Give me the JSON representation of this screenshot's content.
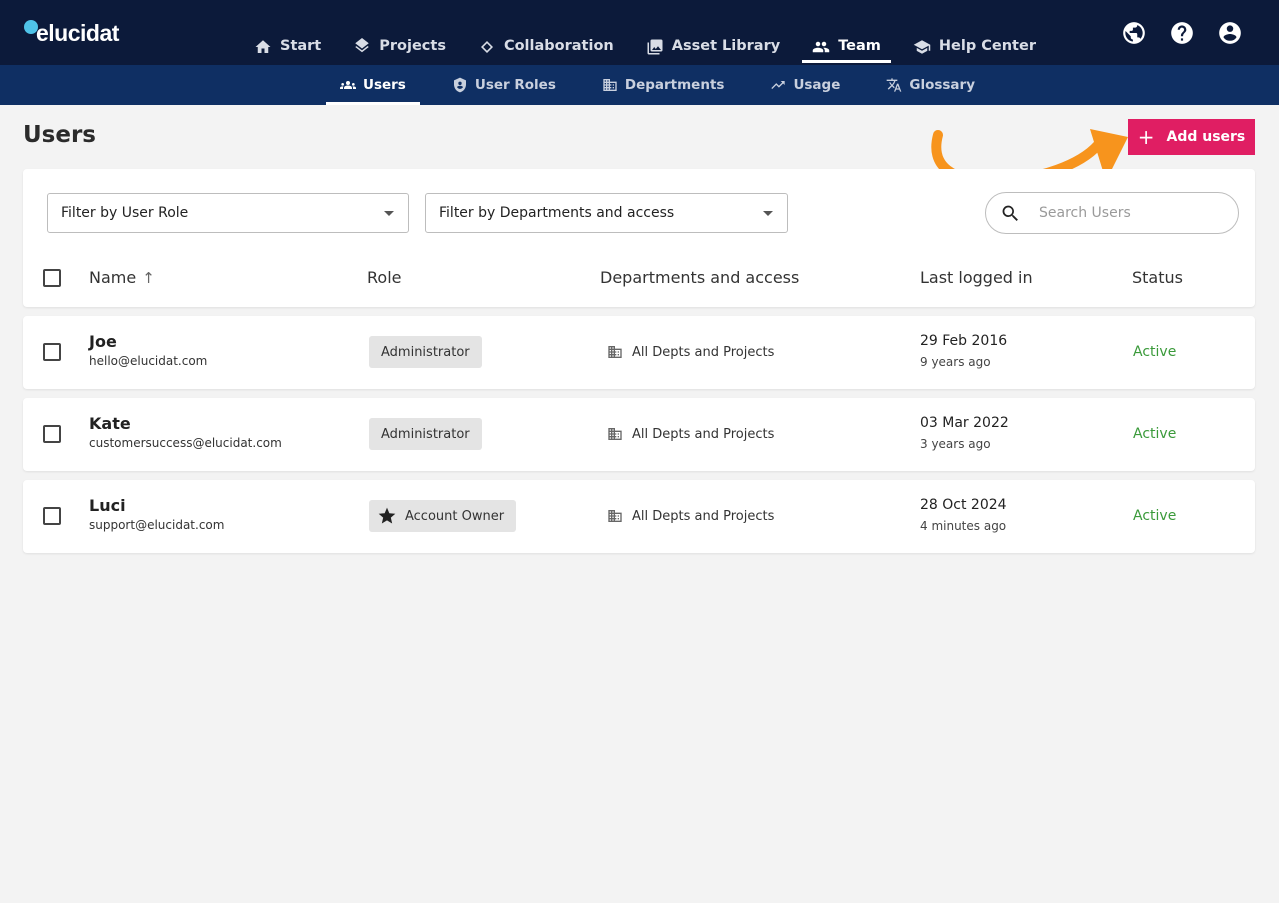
{
  "brand": {
    "logo_text": "elucidat"
  },
  "main_nav": [
    {
      "label": "Start",
      "icon": "home-icon"
    },
    {
      "label": "Projects",
      "icon": "layers-icon"
    },
    {
      "label": "Collaboration",
      "icon": "handshake-icon"
    },
    {
      "label": "Asset Library",
      "icon": "images-icon"
    },
    {
      "label": "Team",
      "icon": "team-icon",
      "active": true
    },
    {
      "label": "Help Center",
      "icon": "school-icon"
    }
  ],
  "top_icons": [
    "globe-icon",
    "help-icon",
    "account-icon"
  ],
  "sub_nav": [
    {
      "label": "Users",
      "icon": "users-icon",
      "active": true
    },
    {
      "label": "User Roles",
      "icon": "shield-icon"
    },
    {
      "label": "Departments",
      "icon": "building-icon"
    },
    {
      "label": "Usage",
      "icon": "trend-icon"
    },
    {
      "label": "Glossary",
      "icon": "translate-icon"
    }
  ],
  "page": {
    "title": "Users",
    "add_button": "Add users",
    "annotation_color": "#f7941d",
    "accent_color": "#e01e63"
  },
  "filters": {
    "role_filter": "Filter by User Role",
    "dept_filter": "Filter by Departments and access",
    "search_placeholder": "Search Users"
  },
  "table": {
    "columns": {
      "name": "Name",
      "role": "Role",
      "departments": "Departments and access",
      "last_logged_in": "Last logged in",
      "status": "Status"
    },
    "sort": {
      "column": "Name",
      "direction": "ascending"
    },
    "rows": [
      {
        "name": "Joe",
        "email": "hello@elucidat.com",
        "role": "Administrator",
        "departments": "All Depts and Projects",
        "last_date": "29 Feb 2016",
        "last_ago": "9 years ago",
        "status": "Active"
      },
      {
        "name": "Kate",
        "email": "customersuccess@elucidat.com",
        "role": "Administrator",
        "departments": "All Depts and Projects",
        "last_date": "03 Mar 2022",
        "last_ago": "3 years ago",
        "status": "Active"
      },
      {
        "name": "Luci",
        "email": "support@elucidat.com",
        "role": "Account Owner",
        "role_icon": "star-icon",
        "departments": "All Depts and Projects",
        "last_date": "28 Oct 2024",
        "last_ago": "4 minutes ago",
        "status": "Active"
      }
    ]
  }
}
